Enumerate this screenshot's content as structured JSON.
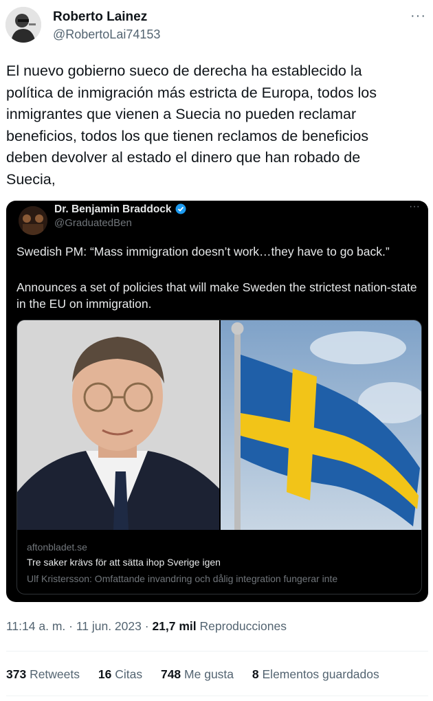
{
  "author": {
    "name": "Roberto Lainez",
    "handle": "@RobertoLai74153"
  },
  "tweet": {
    "text": "El nuevo gobierno sueco de derecha ha establecido la\npolítica de inmigración más estricta de Europa, todos los\ninmigrantes que vienen a Suecia no pueden reclamar\nbeneficios, todos los que tienen reclamos de beneficios\ndeben devolver al estado el dinero que han robado de\nSuecia,"
  },
  "quoted": {
    "name": "Dr. Benjamin Braddock",
    "handle": "@GraduatedBen",
    "text_line1": "Swedish PM: “Mass immigration doesn’t work…they have to go back.”",
    "text_line2": "Announces a set of policies that will make Sweden the strictest nation-state in the EU on immigration.",
    "link": {
      "domain": "aftonbladet.se",
      "title": "Tre saker krävs för att sätta ihop Sverige igen",
      "description": "Ulf Kristersson: Omfattande invandring och dålig integration fungerar inte"
    }
  },
  "meta": {
    "time": "11:14 a. m.",
    "sep1": " · ",
    "date": "11 jun. 2023",
    "sep2": " · ",
    "views_count": "21,7 mil",
    "views_label": " Reproducciones"
  },
  "stats": [
    {
      "count": "373",
      "label": " Retweets"
    },
    {
      "count": "16",
      "label": " Citas"
    },
    {
      "count": "748",
      "label": " Me gusta"
    },
    {
      "count": "8",
      "label": " Elementos guardados"
    }
  ],
  "colors": {
    "verified": "#1d9bf0",
    "flag_blue": "#1f5fa8",
    "flag_yellow": "#f2c418"
  },
  "icons": {
    "more": "more-horizontal-icon",
    "verified": "verified-badge-icon"
  }
}
